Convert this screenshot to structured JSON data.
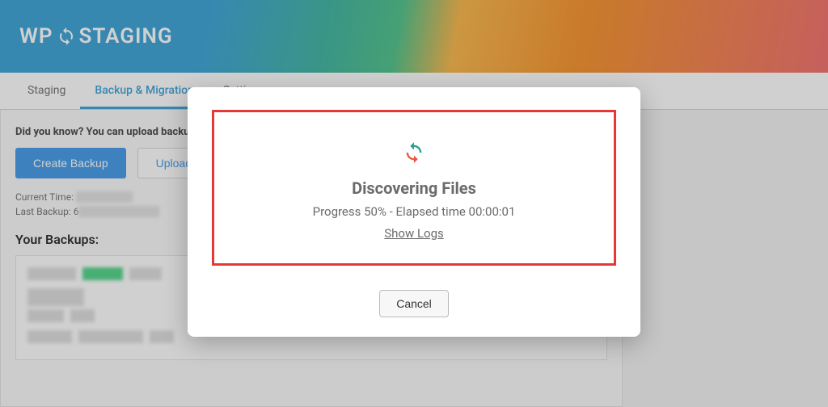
{
  "logo": {
    "prefix": "WP",
    "suffix": "STAGING"
  },
  "tabs": {
    "staging": "Staging",
    "backup": "Backup & Migration",
    "settings": "Settings"
  },
  "tip": "Did you know? You can upload backup files",
  "buttons": {
    "create": "Create Backup",
    "upload": "Upload Backup"
  },
  "meta": {
    "current_label": "Current Time:",
    "last_label": "Last Backup:",
    "last_prefix": "6"
  },
  "section_title": "Your Backups:",
  "modal": {
    "heading": "Discovering Files",
    "progress": "Progress 50% - Elapsed time 00:00:01",
    "show_logs": "Show Logs",
    "cancel": "Cancel"
  }
}
